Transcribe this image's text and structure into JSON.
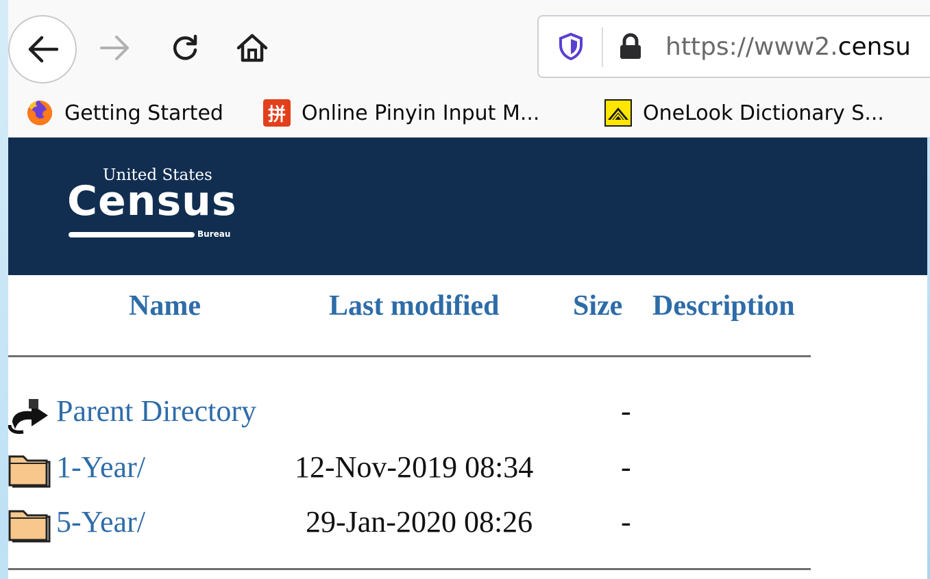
{
  "browser": {
    "url_prefix": "https://www2.",
    "url_host": "censu",
    "bookmarks": [
      {
        "label": "Getting Started",
        "icon": "firefox-icon"
      },
      {
        "label": "Online Pinyin Input M...",
        "icon": "pinyin-icon",
        "icon_glyph": "拼"
      },
      {
        "label": "OneLook Dictionary S...",
        "icon": "onelook-icon"
      }
    ]
  },
  "site": {
    "logo_top": "United States",
    "logo_main": "Census",
    "logo_bureau": "Bureau"
  },
  "listing": {
    "headers": {
      "name": "Name",
      "last_modified": "Last modified",
      "size": "Size",
      "description": "Description"
    },
    "rows": [
      {
        "name": "Parent Directory",
        "modified": "",
        "size": "-",
        "icon": "back-directory-icon"
      },
      {
        "name": "1-Year/",
        "modified": "12-Nov-2019 08:34",
        "size": "-",
        "icon": "folder-icon"
      },
      {
        "name": "5-Year/",
        "modified": "29-Jan-2020 08:26",
        "size": "-",
        "icon": "folder-icon"
      }
    ]
  },
  "colors": {
    "header_bg": "#112e51",
    "link": "#2e6ca8"
  }
}
